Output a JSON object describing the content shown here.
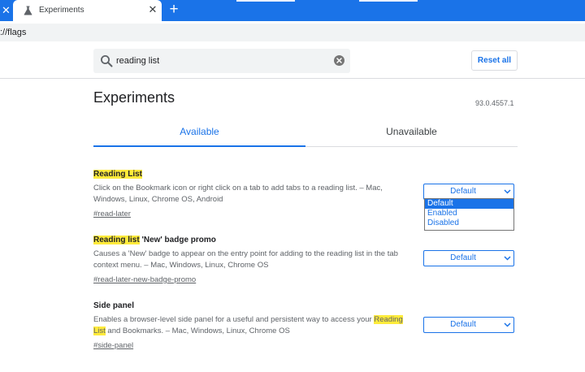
{
  "browser": {
    "tab_title": "Experiments",
    "url": "://flags",
    "icons": {
      "tab_close": "close-icon",
      "new_tab": "plus-icon",
      "favicon": "flask-icon"
    }
  },
  "header": {
    "search_value": "reading list",
    "reset_label": "Reset all"
  },
  "main": {
    "title": "Experiments",
    "version": "93.0.4557.1",
    "tabs": [
      {
        "label": "Available",
        "active": true
      },
      {
        "label": "Unavailable",
        "active": false
      }
    ]
  },
  "flags": [
    {
      "name_highlight": "Reading List",
      "name_rest": "",
      "desc_before": "Click on the Bookmark icon or right click on a tab to add tabs to a reading list. – Mac, Windows, Linux, Chrome OS, Android",
      "desc_highlight": "",
      "desc_after": "",
      "link": "#read-later",
      "select_value": "Default"
    },
    {
      "name_highlight": "Reading list",
      "name_rest": " 'New' badge promo",
      "desc_before": "Causes a 'New' badge to appear on the entry point for adding to the reading list in the tab context menu. – Mac, Windows, Linux, Chrome OS",
      "desc_highlight": "",
      "desc_after": "",
      "link": "#read-later-new-badge-promo",
      "select_value": "Default"
    },
    {
      "name_highlight": "",
      "name_rest": "Side panel",
      "desc_before": "Enables a browser-level side panel for a useful and persistent way to access your ",
      "desc_highlight": "Reading List",
      "desc_after": " and Bookmarks. – Mac, Windows, Linux, Chrome OS",
      "link": "#side-panel",
      "select_value": "Default"
    }
  ],
  "dropdown": {
    "options": [
      "Default",
      "Enabled",
      "Disabled"
    ],
    "selected": "Default"
  },
  "colors": {
    "accent": "#1a73e8",
    "highlight": "#ffeb3b",
    "text": "#202124",
    "muted": "#5f6368"
  }
}
